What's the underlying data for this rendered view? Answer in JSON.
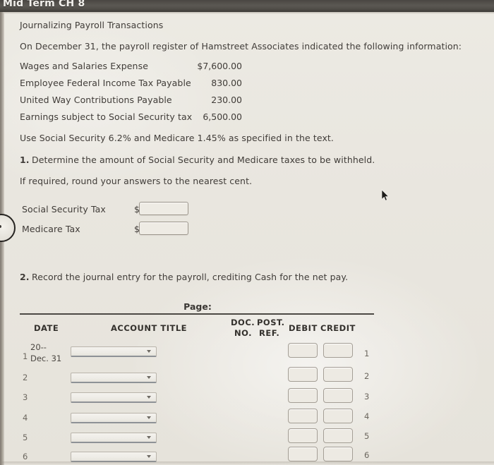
{
  "window": {
    "title": "Mid Term CH 8"
  },
  "problem": {
    "heading": "Journalizing Payroll Transactions",
    "intro": "On December 31, the payroll register of Hamstreet Associates indicated the following information:",
    "line_items": [
      {
        "label": "Wages and Salaries Expense",
        "amount": "$7,600.00"
      },
      {
        "label": "Employee Federal Income Tax Payable",
        "amount": "830.00"
      },
      {
        "label": "United Way Contributions Payable",
        "amount": "230.00"
      },
      {
        "label": "Earnings subject to Social Security tax",
        "amount": "6,500.00"
      }
    ],
    "rates_note": "Use Social Security 6.2% and Medicare 1.45% as specified in the text.",
    "requirement_1_number": "1.",
    "requirement_1_text": "Determine the amount of Social Security and Medicare taxes to be withheld.",
    "rounding_note": "If required, round your answers to the nearest cent.",
    "requirement_2_number": "2.",
    "requirement_2_text": "Record the journal entry for the payroll, crediting Cash for the net pay."
  },
  "answers": {
    "currency_symbol": "$",
    "fields": [
      {
        "label": "Social Security Tax",
        "value": "",
        "placeholder": ""
      },
      {
        "label": "Medicare Tax",
        "value": "",
        "placeholder": ""
      }
    ]
  },
  "journal": {
    "page_label": "Page:",
    "page_value": "",
    "headers": {
      "date": "DATE",
      "account_title": "ACCOUNT TITLE",
      "doc_no_line1": "DOC.",
      "doc_no_line2": "NO.",
      "post_ref_line1": "POST.",
      "post_ref_line2": "REF.",
      "debit": "DEBIT",
      "credit": "CREDIT"
    },
    "rows": [
      {
        "num": "1",
        "date_line1": "20--",
        "date_line2": "Dec. 31",
        "account": "",
        "doc_no": "",
        "post_ref": "",
        "debit": "",
        "credit": "",
        "num_right": "1"
      },
      {
        "num": "2",
        "date_line1": "",
        "date_line2": "",
        "account": "",
        "doc_no": "",
        "post_ref": "",
        "debit": "",
        "credit": "",
        "num_right": "2"
      },
      {
        "num": "3",
        "date_line1": "",
        "date_line2": "",
        "account": "",
        "doc_no": "",
        "post_ref": "",
        "debit": "",
        "credit": "",
        "num_right": "3"
      },
      {
        "num": "4",
        "date_line1": "",
        "date_line2": "",
        "account": "",
        "doc_no": "",
        "post_ref": "",
        "debit": "",
        "credit": "",
        "num_right": "4"
      },
      {
        "num": "5",
        "date_line1": "",
        "date_line2": "",
        "account": "",
        "doc_no": "",
        "post_ref": "",
        "debit": "",
        "credit": "",
        "num_right": "5"
      },
      {
        "num": "6",
        "date_line1": "",
        "date_line2": "",
        "account": "",
        "doc_no": "",
        "post_ref": "",
        "debit": "",
        "credit": "",
        "num_right": "6"
      }
    ]
  },
  "colors": {
    "titlebar": "#504d48",
    "paper": "#e9e6df",
    "text": "#403c38",
    "rule": "#4c4944"
  }
}
